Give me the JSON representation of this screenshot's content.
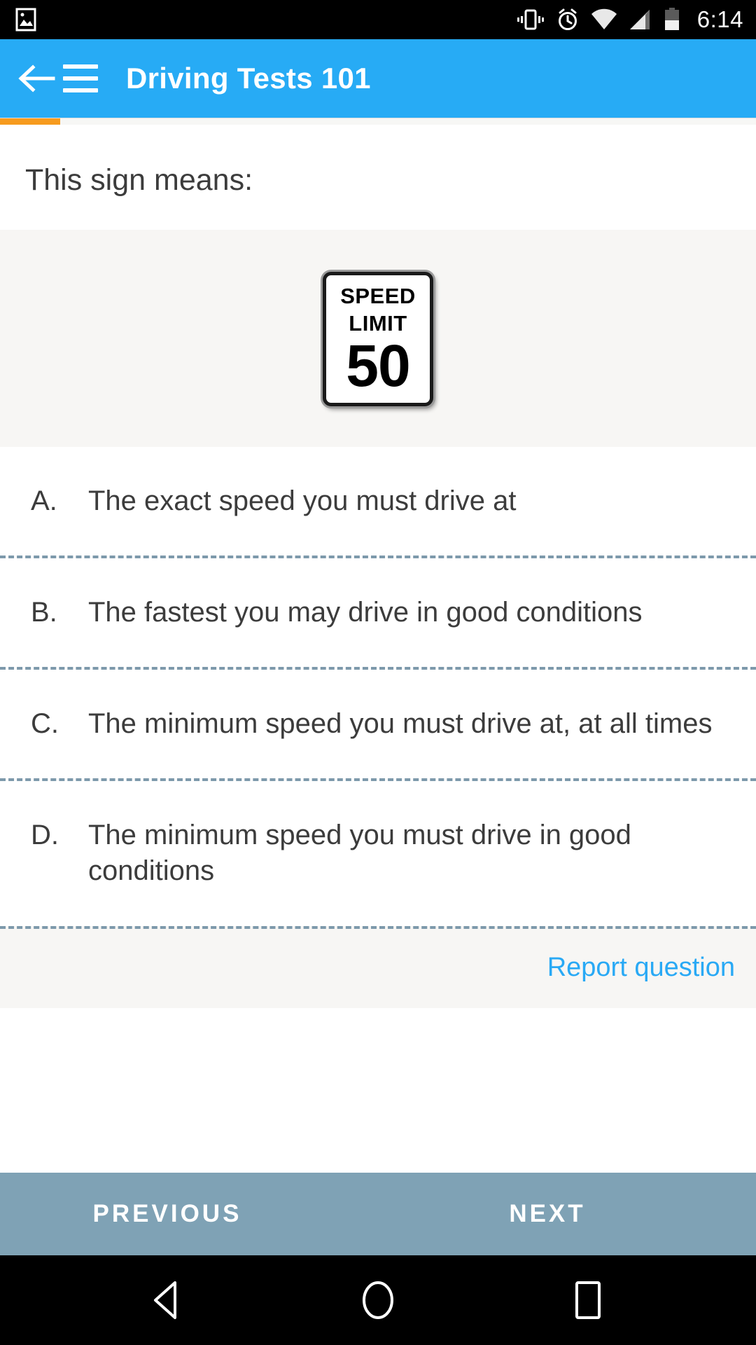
{
  "status_bar": {
    "icons": [
      "photo-icon",
      "vibrate-icon",
      "alarm-icon",
      "wifi-icon",
      "signal-icon",
      "battery-icon"
    ],
    "time": "6:14"
  },
  "app_bar": {
    "back_label": "back-arrow",
    "menu_label": "menu",
    "title": "Driving Tests 101",
    "background_color": "#27ABF5"
  },
  "progress": {
    "percent": 8,
    "fill_color": "#F79B1E",
    "track_color": "#F7F7F5"
  },
  "question": {
    "prompt": "This sign means:"
  },
  "sign_image": {
    "line1": "SPEED",
    "line2": "LIMIT",
    "value": "50",
    "alt": "speed-limit-50-sign"
  },
  "options": [
    {
      "letter": "A.",
      "text": "The exact speed you must drive at"
    },
    {
      "letter": "B.",
      "text": "The fastest you may drive in good conditions"
    },
    {
      "letter": "C.",
      "text": "The minimum speed you must drive at, at all times"
    },
    {
      "letter": "D.",
      "text": "The minimum speed you must drive in good conditions"
    }
  ],
  "report": {
    "label": "Report question",
    "color": "#29A9F5"
  },
  "bottom_nav": {
    "previous_label": "PREVIOUS",
    "next_label": "NEXT",
    "background_color": "#7FA2B5"
  },
  "system_nav": {
    "back": "back-triangle-icon",
    "home": "home-circle-icon",
    "recents": "recents-square-icon"
  }
}
